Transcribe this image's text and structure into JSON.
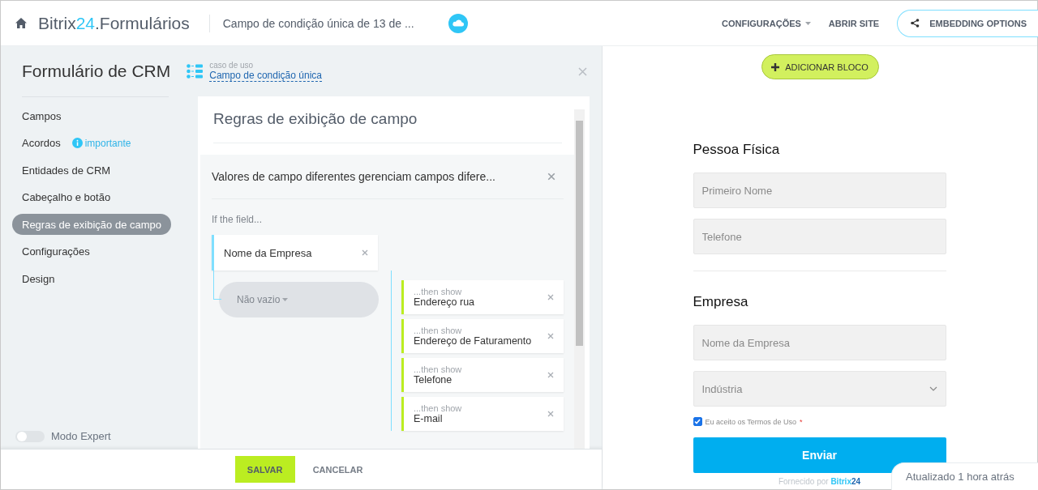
{
  "header": {
    "brand": {
      "name": "Bitrix",
      "number": "24",
      "suffix": ".Formulários"
    },
    "document_title": "Campo de condição única de 13 de ...",
    "menu": [
      {
        "label": "CONFIGURAÇÕES",
        "dropdown": true
      },
      {
        "label": "ABRIR SITE",
        "dropdown": false
      }
    ],
    "embed_button": "EMBEDDING OPTIONS"
  },
  "panel": {
    "title": "Formulário de CRM",
    "use_case_label": "caso de uso",
    "use_case_link": "Campo de condição única",
    "nav": [
      {
        "label": "Campos",
        "selected": false
      },
      {
        "label": "Acordos",
        "selected": false,
        "badge": "importante"
      },
      {
        "label": "Entidades de CRM",
        "selected": false
      },
      {
        "label": "Cabeçalho e botão",
        "selected": false
      },
      {
        "label": "Regras de exibição de campo",
        "selected": true
      },
      {
        "label": "Configurações",
        "selected": false
      },
      {
        "label": "Design",
        "selected": false
      }
    ],
    "expert_mode": {
      "label": "Modo Expert",
      "on": false
    },
    "section_title": "Regras de exibição de campo",
    "rule": {
      "title": "Valores de campo diferentes gerenciam campos difere...",
      "if_label": "If the field...",
      "field": "Nome da Empresa",
      "condition": "Não vazio",
      "actions": [
        {
          "prefix": "...then show",
          "field": "Endereço rua"
        },
        {
          "prefix": "...then show",
          "field": "Endereço de Faturamento"
        },
        {
          "prefix": "...then show",
          "field": "Telefone"
        },
        {
          "prefix": "...then show",
          "field": "E-mail"
        }
      ]
    },
    "buttons": {
      "save": "SALVAR",
      "cancel": "CANCELAR"
    }
  },
  "preview": {
    "add_block": "ADICIONAR BLOCO",
    "sections": [
      {
        "title": "Pessoa Física",
        "fields": [
          {
            "kind": "text",
            "placeholder": "Primeiro Nome"
          },
          {
            "kind": "text",
            "placeholder": "Telefone"
          }
        ]
      },
      {
        "title": "Empresa",
        "fields": [
          {
            "kind": "text",
            "placeholder": "Nome da Empresa"
          },
          {
            "kind": "select",
            "placeholder": "Indústria"
          }
        ]
      }
    ],
    "terms": {
      "label": "Eu aceito os Termos de Uso",
      "required_mark": "*",
      "checked": true
    },
    "submit": "Enviar",
    "updated": "Atualizado 1 hora atrás",
    "powered": {
      "label": "Fornecido por",
      "name": "Bitrix",
      "number": "24"
    }
  }
}
